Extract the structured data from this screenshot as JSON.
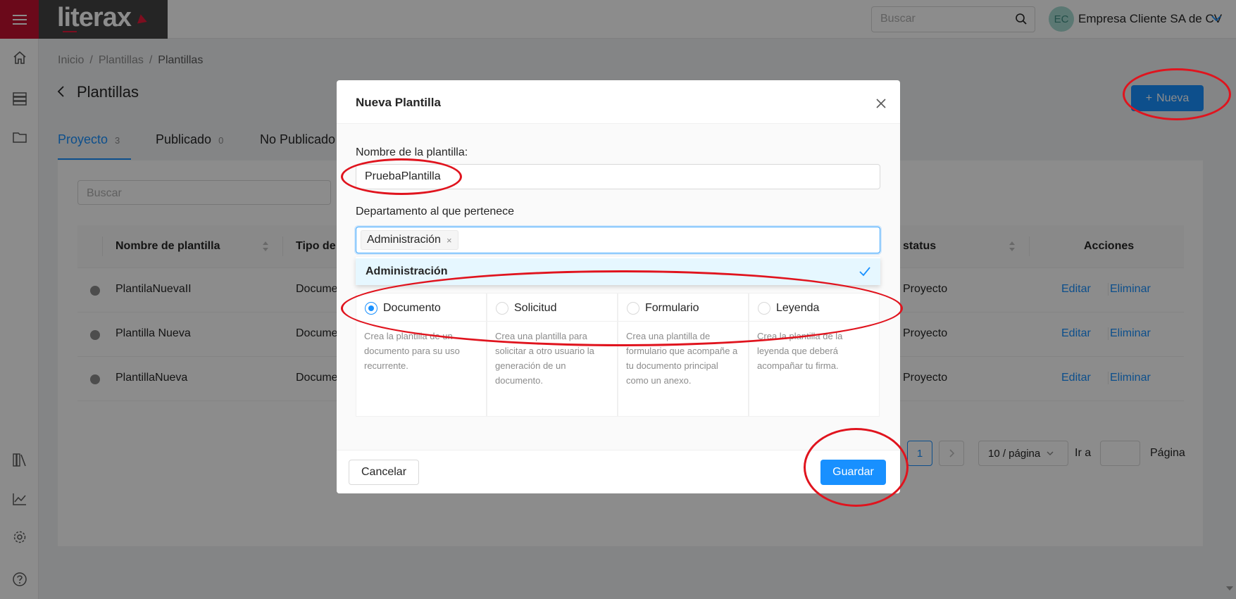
{
  "brand": {
    "logo_text": "literax"
  },
  "header": {
    "search_placeholder": "Buscar",
    "avatar_initials": "EC",
    "company_name": "Empresa Cliente SA de CV"
  },
  "sidebar": {
    "icons": [
      "home-icon",
      "database-icon",
      "folder-icon",
      "library-icon",
      "chart-icon",
      "gear-icon",
      "help-icon"
    ]
  },
  "breadcrumb": [
    "Inicio",
    "Plantillas",
    "Plantillas"
  ],
  "page": {
    "title": "Plantillas",
    "new_button_label": "Nueva"
  },
  "tabs": [
    {
      "label": "Proyecto",
      "count": "3"
    },
    {
      "label": "Publicado",
      "count": "0"
    },
    {
      "label": "No Publicado",
      "count": ""
    }
  ],
  "table": {
    "search_placeholder": "Buscar",
    "columns": [
      "Nombre de plantilla",
      "Tipo de",
      "status",
      "Acciones"
    ],
    "rows": [
      {
        "name": "PlantilaNuevaII",
        "type": "Docume",
        "status": "Proyecto",
        "edit": "Editar",
        "delete": "Eliminar"
      },
      {
        "name": "Plantilla Nueva",
        "type": "Docume",
        "status": "Proyecto",
        "edit": "Editar",
        "delete": "Eliminar"
      },
      {
        "name": "PlantillaNueva",
        "type": "Docume",
        "status": "Proyecto",
        "edit": "Editar",
        "delete": "Eliminar"
      }
    ]
  },
  "pagination": {
    "current_page": "1",
    "page_size": "10 / página",
    "goto_label": "Ir a",
    "page_label": "Página"
  },
  "modal": {
    "title": "Nueva Plantilla",
    "name_label": "Nombre de la plantilla",
    "name_value": "PruebaPlantilla",
    "dept_label": "Departamento al que pertenece",
    "dept_tag": "Administración",
    "dept_option": "Administración",
    "types": [
      {
        "label": "Documento",
        "desc": "Crea la plantilla de un documento para su uso recurrente.",
        "checked": true
      },
      {
        "label": "Solicitud",
        "desc": "Crea una plantilla para solicitar a otro usuario la generación de un documento.",
        "checked": false
      },
      {
        "label": "Formulario",
        "desc": "Crea una plantilla de formulario que acompañe a tu documento principal como un anexo.",
        "checked": false
      },
      {
        "label": "Leyenda",
        "desc": "Crea la plantilla de la leyenda que deberá acompañar tu firma.",
        "checked": false
      }
    ],
    "cancel_label": "Cancelar",
    "save_label": "Guardar"
  },
  "colors": {
    "brand_red": "#c41230",
    "primary_blue": "#1890ff",
    "annotation_red": "#e0141e"
  }
}
